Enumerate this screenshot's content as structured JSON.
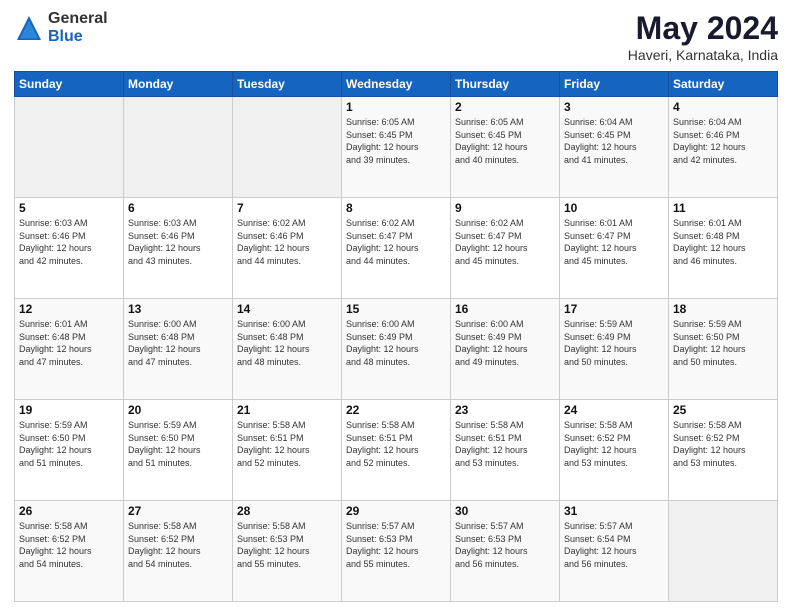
{
  "header": {
    "logo_general": "General",
    "logo_blue": "Blue",
    "title": "May 2024",
    "subtitle": "Haveri, Karnataka, India"
  },
  "weekdays": [
    "Sunday",
    "Monday",
    "Tuesday",
    "Wednesday",
    "Thursday",
    "Friday",
    "Saturday"
  ],
  "weeks": [
    [
      {
        "day": "",
        "info": ""
      },
      {
        "day": "",
        "info": ""
      },
      {
        "day": "",
        "info": ""
      },
      {
        "day": "1",
        "info": "Sunrise: 6:05 AM\nSunset: 6:45 PM\nDaylight: 12 hours\nand 39 minutes."
      },
      {
        "day": "2",
        "info": "Sunrise: 6:05 AM\nSunset: 6:45 PM\nDaylight: 12 hours\nand 40 minutes."
      },
      {
        "day": "3",
        "info": "Sunrise: 6:04 AM\nSunset: 6:45 PM\nDaylight: 12 hours\nand 41 minutes."
      },
      {
        "day": "4",
        "info": "Sunrise: 6:04 AM\nSunset: 6:46 PM\nDaylight: 12 hours\nand 42 minutes."
      }
    ],
    [
      {
        "day": "5",
        "info": "Sunrise: 6:03 AM\nSunset: 6:46 PM\nDaylight: 12 hours\nand 42 minutes."
      },
      {
        "day": "6",
        "info": "Sunrise: 6:03 AM\nSunset: 6:46 PM\nDaylight: 12 hours\nand 43 minutes."
      },
      {
        "day": "7",
        "info": "Sunrise: 6:02 AM\nSunset: 6:46 PM\nDaylight: 12 hours\nand 44 minutes."
      },
      {
        "day": "8",
        "info": "Sunrise: 6:02 AM\nSunset: 6:47 PM\nDaylight: 12 hours\nand 44 minutes."
      },
      {
        "day": "9",
        "info": "Sunrise: 6:02 AM\nSunset: 6:47 PM\nDaylight: 12 hours\nand 45 minutes."
      },
      {
        "day": "10",
        "info": "Sunrise: 6:01 AM\nSunset: 6:47 PM\nDaylight: 12 hours\nand 45 minutes."
      },
      {
        "day": "11",
        "info": "Sunrise: 6:01 AM\nSunset: 6:48 PM\nDaylight: 12 hours\nand 46 minutes."
      }
    ],
    [
      {
        "day": "12",
        "info": "Sunrise: 6:01 AM\nSunset: 6:48 PM\nDaylight: 12 hours\nand 47 minutes."
      },
      {
        "day": "13",
        "info": "Sunrise: 6:00 AM\nSunset: 6:48 PM\nDaylight: 12 hours\nand 47 minutes."
      },
      {
        "day": "14",
        "info": "Sunrise: 6:00 AM\nSunset: 6:48 PM\nDaylight: 12 hours\nand 48 minutes."
      },
      {
        "day": "15",
        "info": "Sunrise: 6:00 AM\nSunset: 6:49 PM\nDaylight: 12 hours\nand 48 minutes."
      },
      {
        "day": "16",
        "info": "Sunrise: 6:00 AM\nSunset: 6:49 PM\nDaylight: 12 hours\nand 49 minutes."
      },
      {
        "day": "17",
        "info": "Sunrise: 5:59 AM\nSunset: 6:49 PM\nDaylight: 12 hours\nand 50 minutes."
      },
      {
        "day": "18",
        "info": "Sunrise: 5:59 AM\nSunset: 6:50 PM\nDaylight: 12 hours\nand 50 minutes."
      }
    ],
    [
      {
        "day": "19",
        "info": "Sunrise: 5:59 AM\nSunset: 6:50 PM\nDaylight: 12 hours\nand 51 minutes."
      },
      {
        "day": "20",
        "info": "Sunrise: 5:59 AM\nSunset: 6:50 PM\nDaylight: 12 hours\nand 51 minutes."
      },
      {
        "day": "21",
        "info": "Sunrise: 5:58 AM\nSunset: 6:51 PM\nDaylight: 12 hours\nand 52 minutes."
      },
      {
        "day": "22",
        "info": "Sunrise: 5:58 AM\nSunset: 6:51 PM\nDaylight: 12 hours\nand 52 minutes."
      },
      {
        "day": "23",
        "info": "Sunrise: 5:58 AM\nSunset: 6:51 PM\nDaylight: 12 hours\nand 53 minutes."
      },
      {
        "day": "24",
        "info": "Sunrise: 5:58 AM\nSunset: 6:52 PM\nDaylight: 12 hours\nand 53 minutes."
      },
      {
        "day": "25",
        "info": "Sunrise: 5:58 AM\nSunset: 6:52 PM\nDaylight: 12 hours\nand 53 minutes."
      }
    ],
    [
      {
        "day": "26",
        "info": "Sunrise: 5:58 AM\nSunset: 6:52 PM\nDaylight: 12 hours\nand 54 minutes."
      },
      {
        "day": "27",
        "info": "Sunrise: 5:58 AM\nSunset: 6:52 PM\nDaylight: 12 hours\nand 54 minutes."
      },
      {
        "day": "28",
        "info": "Sunrise: 5:58 AM\nSunset: 6:53 PM\nDaylight: 12 hours\nand 55 minutes."
      },
      {
        "day": "29",
        "info": "Sunrise: 5:57 AM\nSunset: 6:53 PM\nDaylight: 12 hours\nand 55 minutes."
      },
      {
        "day": "30",
        "info": "Sunrise: 5:57 AM\nSunset: 6:53 PM\nDaylight: 12 hours\nand 56 minutes."
      },
      {
        "day": "31",
        "info": "Sunrise: 5:57 AM\nSunset: 6:54 PM\nDaylight: 12 hours\nand 56 minutes."
      },
      {
        "day": "",
        "info": ""
      }
    ]
  ]
}
